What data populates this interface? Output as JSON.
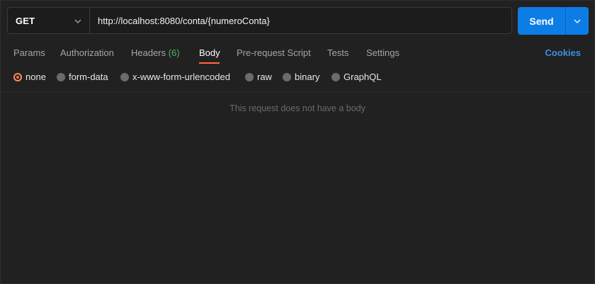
{
  "request": {
    "method": "GET",
    "url": "http://localhost:8080/conta/{numeroConta}",
    "send_label": "Send"
  },
  "tabs": [
    {
      "label": "Params"
    },
    {
      "label": "Authorization"
    },
    {
      "label": "Headers",
      "count": "(6)"
    },
    {
      "label": "Body",
      "active": true
    },
    {
      "label": "Pre-request Script"
    },
    {
      "label": "Tests"
    },
    {
      "label": "Settings"
    }
  ],
  "cookies_label": "Cookies",
  "body_types": [
    {
      "label": "none",
      "selected": true
    },
    {
      "label": "form-data"
    },
    {
      "label": "x-www-form-urlencoded"
    },
    {
      "label": "raw"
    },
    {
      "label": "binary"
    },
    {
      "label": "GraphQL"
    }
  ],
  "empty_message": "This request does not have a body",
  "colors": {
    "background": "#212121",
    "send_button": "#0d7de6",
    "active_tab_underline": "#ff6c37",
    "header_count": "#4fb664",
    "cookies_link": "#3b8fe0"
  }
}
